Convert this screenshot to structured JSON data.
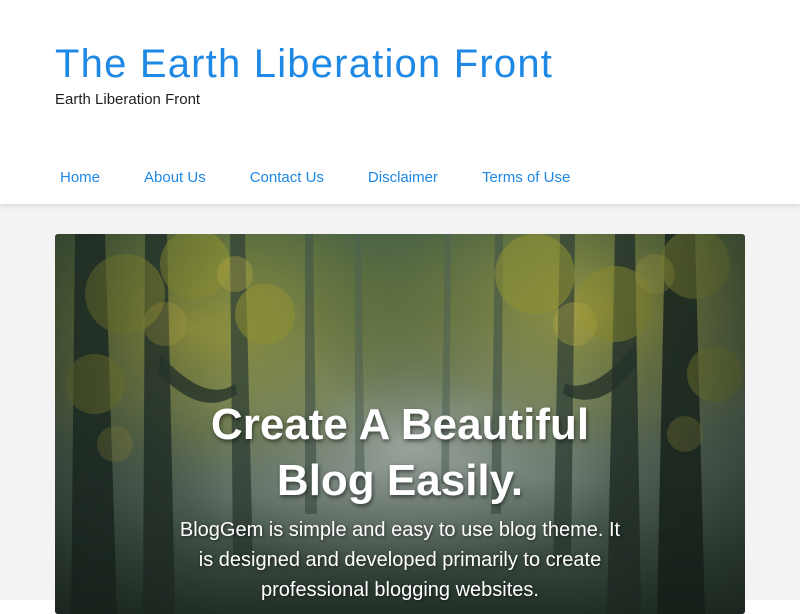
{
  "site": {
    "title": "The Earth Liberation Front",
    "tagline": "Earth Liberation Front"
  },
  "nav": {
    "items": [
      {
        "label": "Home"
      },
      {
        "label": "About Us"
      },
      {
        "label": "Contact Us"
      },
      {
        "label": "Disclaimer"
      },
      {
        "label": "Terms of Use"
      }
    ]
  },
  "hero": {
    "heading": "Create A Beautiful Blog Easily.",
    "text": "BlogGem is simple and easy to use blog theme. It is designed and developed primarily to create professional blogging websites."
  },
  "colors": {
    "accent": "#1e88e5",
    "tagline": "#222222",
    "page_background": "#f3f3f3"
  }
}
